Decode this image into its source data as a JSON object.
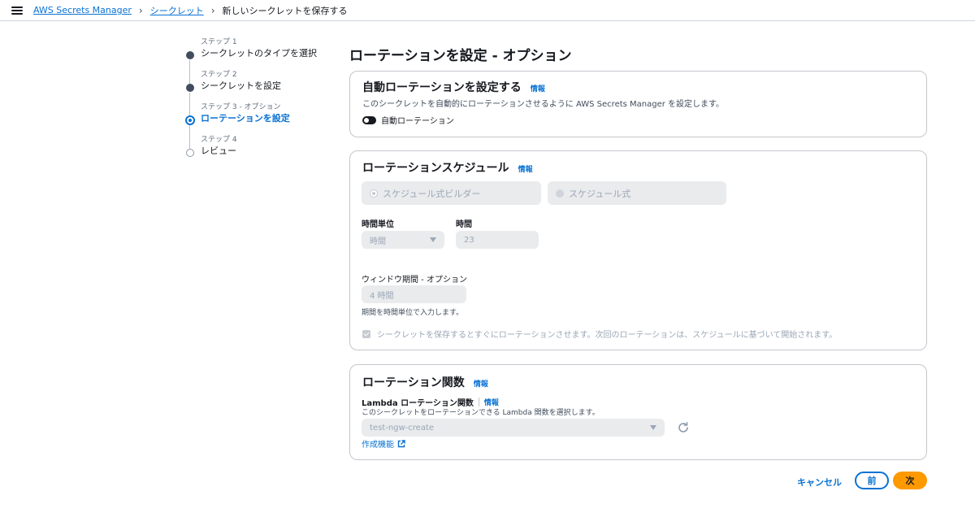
{
  "breadcrumb": {
    "service": "AWS Secrets Manager",
    "secrets": "シークレット",
    "current": "新しいシークレットを保存する"
  },
  "steps": [
    {
      "sub": "ステップ 1",
      "label": "シークレットのタイプを選択",
      "state": "done"
    },
    {
      "sub": "ステップ 2",
      "label": "シークレットを設定",
      "state": "done"
    },
    {
      "sub": "ステップ 3 - オプション",
      "label": "ローテーションを設定",
      "state": "active"
    },
    {
      "sub": "ステップ 4",
      "label": "レビュー",
      "state": "future"
    }
  ],
  "page": {
    "title": "ローテーションを設定 - オプション"
  },
  "auto_rotation": {
    "heading": "自動ローテーションを設定する",
    "info": "情報",
    "description": "このシークレットを自動的にローテーションさせるように AWS Secrets Manager を設定します。",
    "toggle_label": "自動ローテーション",
    "toggle_on": false
  },
  "schedule": {
    "heading": "ローテーションスケジュール",
    "info": "情報",
    "option_builder": "スケジュール式ビルダー",
    "option_expression": "スケジュール式",
    "time_unit_label": "時間単位",
    "time_unit_value": "時間",
    "hours_label": "時間",
    "hours_value": "23",
    "window_label": "ウィンドウ期間 - オプション",
    "window_placeholder": "4 時間",
    "window_hint": "期間を時間単位で入力します。",
    "rotate_now_label": "シークレットを保存するとすぐにローテーションさせます。次回のローテーションは、スケジュールに基づいて開始されます。"
  },
  "rotation_function": {
    "heading": "ローテーション関数",
    "info": "情報",
    "lambda_label": "Lambda ローテーション関数",
    "lambda_info": "情報",
    "lambda_desc": "このシークレットをローテーションできる Lambda 関数を選択します。",
    "lambda_value": "test-ngw-create",
    "create_link": "作成機能"
  },
  "footer": {
    "cancel": "キャンセル",
    "previous": "前",
    "next": "次"
  },
  "colors": {
    "accent": "#0972d3",
    "primary_button": "#ff9900"
  }
}
